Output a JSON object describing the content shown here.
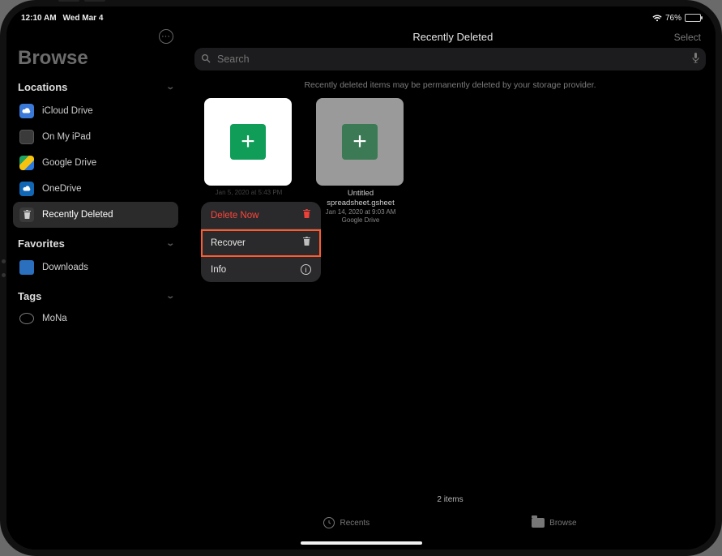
{
  "status": {
    "time": "12:10 AM",
    "date": "Wed Mar 4",
    "battery_pct": "76%",
    "battery_fill_pct": 76
  },
  "sidebar": {
    "title": "Browse",
    "sections": {
      "locations": {
        "header": "Locations",
        "items": [
          {
            "label": "iCloud Drive"
          },
          {
            "label": "On My iPad"
          },
          {
            "label": "Google Drive"
          },
          {
            "label": "OneDrive"
          },
          {
            "label": "Recently Deleted"
          }
        ]
      },
      "favorites": {
        "header": "Favorites",
        "items": [
          {
            "label": "Downloads"
          }
        ]
      },
      "tags": {
        "header": "Tags",
        "items": [
          {
            "label": "MoNa"
          }
        ]
      }
    }
  },
  "main": {
    "title": "Recently Deleted",
    "select_label": "Select",
    "search_placeholder": "Search",
    "hint": "Recently deleted items may be permanently deleted by your storage provider.",
    "item_count_label": "2 items",
    "files": [
      {
        "name": "",
        "date": "Jan 5, 2020 at 5:43 PM",
        "location": ""
      },
      {
        "name": "Untitled spreadsheet.gsheet",
        "date": "Jan 14, 2020 at 9:03 AM",
        "location": "Google Drive"
      }
    ],
    "context_menu": {
      "delete_now": "Delete Now",
      "recover": "Recover",
      "info": "Info"
    }
  },
  "tabs": {
    "recents": "Recents",
    "browse": "Browse"
  }
}
